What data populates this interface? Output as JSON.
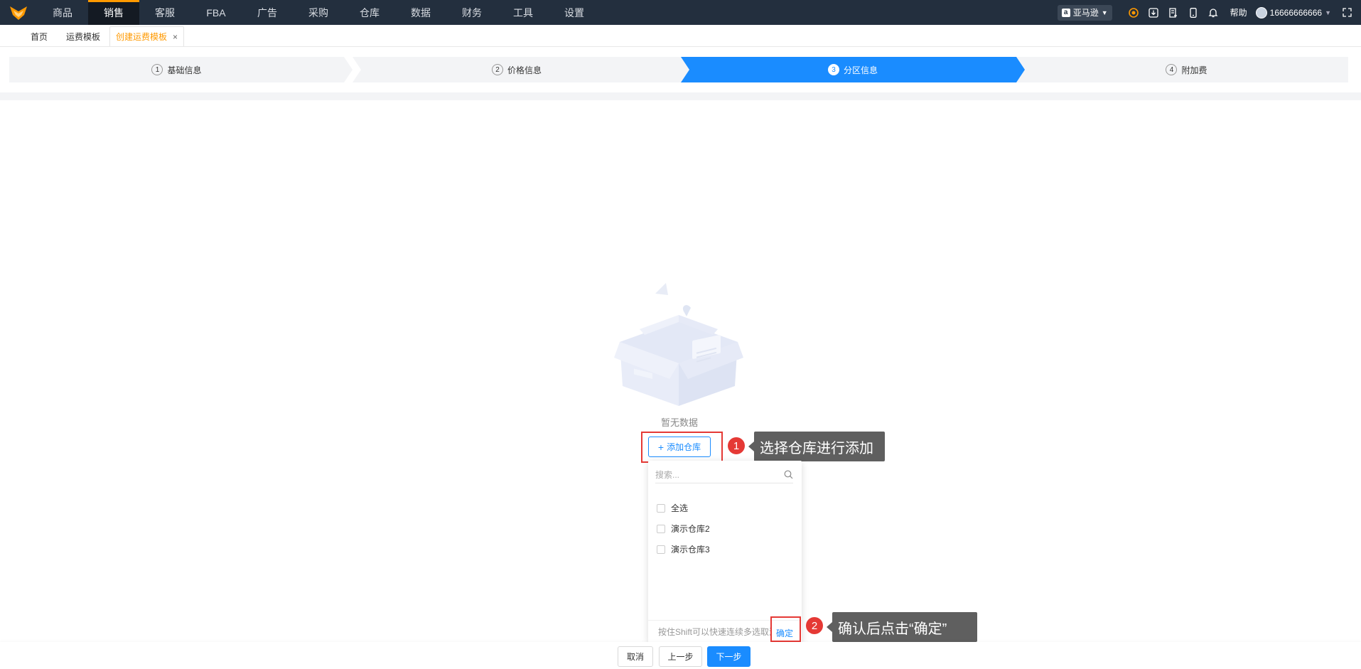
{
  "topnav": {
    "items": [
      {
        "label": "商品"
      },
      {
        "label": "销售"
      },
      {
        "label": "客服"
      },
      {
        "label": "FBA"
      },
      {
        "label": "广告"
      },
      {
        "label": "采购"
      },
      {
        "label": "仓库"
      },
      {
        "label": "数据"
      },
      {
        "label": "财务"
      },
      {
        "label": "工具"
      },
      {
        "label": "设置"
      }
    ],
    "active_index": 1,
    "platform": "亚马逊",
    "help": "帮助",
    "user": "16666666666",
    "accent_color": "#ff9900"
  },
  "tabs": {
    "home": "首页",
    "freight_template": "运费模板",
    "create_template": "创建运费模板",
    "close_symbol": "×"
  },
  "steps": [
    {
      "num": "1",
      "label": "基础信息"
    },
    {
      "num": "2",
      "label": "价格信息"
    },
    {
      "num": "3",
      "label": "分区信息"
    },
    {
      "num": "4",
      "label": "附加费"
    }
  ],
  "active_step": 3,
  "empty": {
    "text": "暂无数据",
    "add_button": "添加仓库",
    "add_icon": "+"
  },
  "callouts": [
    {
      "num": "1",
      "text": "选择仓库进行添加"
    },
    {
      "num": "2",
      "text": "确认后点击“确定”"
    }
  ],
  "dropdown": {
    "search_placeholder": "搜索...",
    "options": [
      {
        "label": "全选",
        "checked": false
      },
      {
        "label": "演示仓库2",
        "checked": false
      },
      {
        "label": "演示仓库3",
        "checked": false
      }
    ],
    "hint": "按住Shift可以快速连续多选取消",
    "confirm": "确定"
  },
  "footer": {
    "cancel": "取消",
    "prev": "上一步",
    "next": "下一步"
  },
  "colors": {
    "primary": "#1a8cff",
    "highlight": "#e53935",
    "nav_bg": "#232f3e"
  }
}
